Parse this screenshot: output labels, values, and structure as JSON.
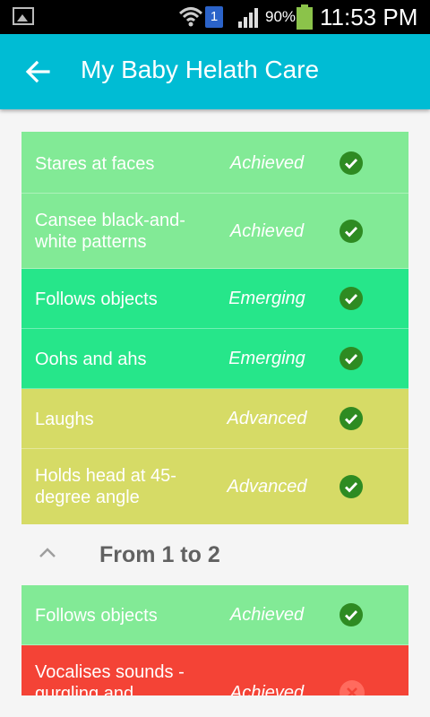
{
  "status_bar": {
    "battery_percent": "90%",
    "time": "11:53 PM",
    "sim_label": "1",
    "icons": [
      "image-icon",
      "wifi-icon",
      "sim-icon",
      "signal-icon",
      "battery-icon"
    ]
  },
  "app_bar": {
    "title": "My Baby Helath Care",
    "back_icon": "arrow-back-icon"
  },
  "groups": [
    {
      "milestones": [
        {
          "name": "Stares at faces",
          "status": "Achieved",
          "done": true
        },
        {
          "name": "Cansee black-and-white patterns",
          "status": "Achieved",
          "done": true
        },
        {
          "name": "Follows objects",
          "status": "Emerging",
          "done": true
        },
        {
          "name": "Oohs and ahs",
          "status": "Emerging",
          "done": true
        },
        {
          "name": "Laughs",
          "status": "Advanced",
          "done": true
        },
        {
          "name": "Holds head at 45-degree angle",
          "status": "Advanced",
          "done": true
        }
      ]
    },
    {
      "label": "From 1 to 2",
      "milestones": [
        {
          "name": "Follows objects",
          "status": "Achieved",
          "done": true
        },
        {
          "name": "Vocalises sounds - gurgling and",
          "status": "Achieved",
          "done": false
        }
      ]
    }
  ],
  "colors": {
    "app_bar": "#00bcd4",
    "achieved": "#82ea96",
    "emerging": "#26e68a",
    "advanced": "#d6db66",
    "not_done": "#f44336",
    "check": "#2e8b22"
  }
}
